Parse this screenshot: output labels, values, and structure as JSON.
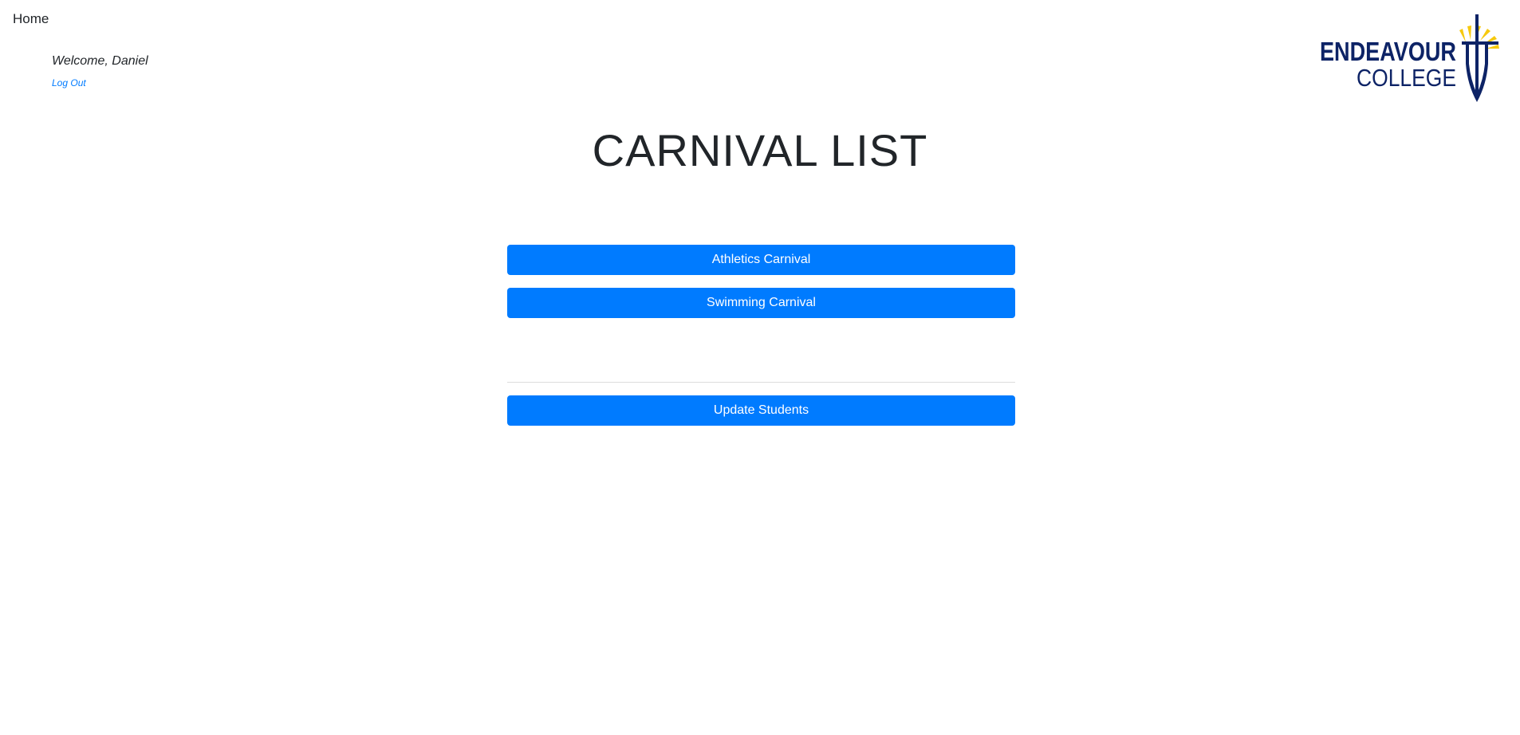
{
  "nav": {
    "home_label": "Home"
  },
  "user": {
    "welcome_text": "Welcome, Daniel",
    "logout_label": "Log Out"
  },
  "logo": {
    "line1": "ENDEAVOUR",
    "line2": "COLLEGE",
    "primary_color": "#0d2366",
    "accent_color": "#f6c90e"
  },
  "main": {
    "title": "CARNIVAL LIST",
    "carnivals": [
      {
        "label": "Athletics Carnival"
      },
      {
        "label": "Swimming Carnival"
      }
    ],
    "update_label": "Update Students"
  },
  "colors": {
    "button": "#007bff",
    "button_text": "#ffffff",
    "link": "#007bff"
  }
}
